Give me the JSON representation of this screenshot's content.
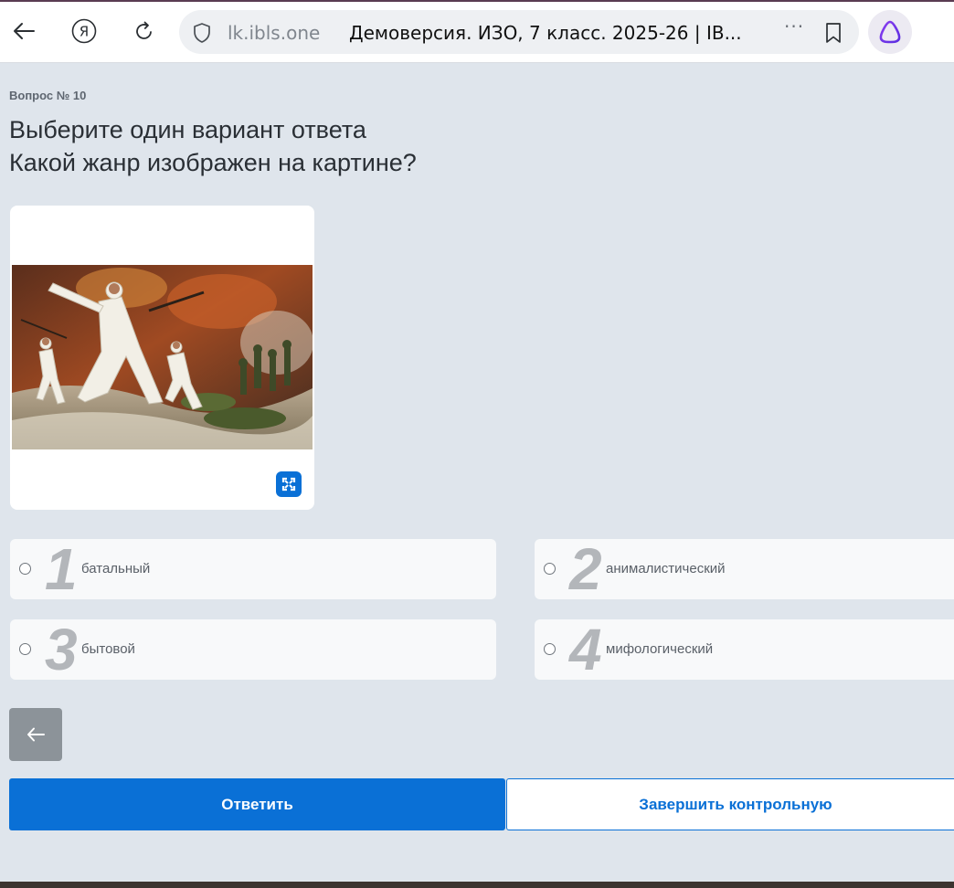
{
  "browser": {
    "domain": "lk.ibls.one",
    "page_title": "Демоверсия. ИЗО, 7 класс. 2025-26 | IB...",
    "more_label": "···"
  },
  "question": {
    "number_label": "Вопрос № 10",
    "instruction": "Выберите один вариант ответа",
    "text": "Какой жанр изображен на картине?"
  },
  "options": [
    {
      "number": "1",
      "label": "батальный"
    },
    {
      "number": "2",
      "label": "анималистический"
    },
    {
      "number": "3",
      "label": "бытовой"
    },
    {
      "number": "4",
      "label": "мифологический"
    }
  ],
  "buttons": {
    "answer": "Ответить",
    "finish": "Завершить контрольную"
  },
  "colors": {
    "accent": "#0a70d6",
    "page_background": "#dfe5ec",
    "option_background": "#f8f9fa",
    "number_gray": "#b3b6ba"
  },
  "icons": {
    "back": "arrow-left-icon",
    "yandex": "yandex-logo-icon",
    "reload": "reload-icon",
    "shield": "shield-icon",
    "bookmark": "bookmark-icon",
    "alice": "alice-assistant-icon",
    "expand": "expand-icon",
    "prev": "arrow-left-icon"
  }
}
